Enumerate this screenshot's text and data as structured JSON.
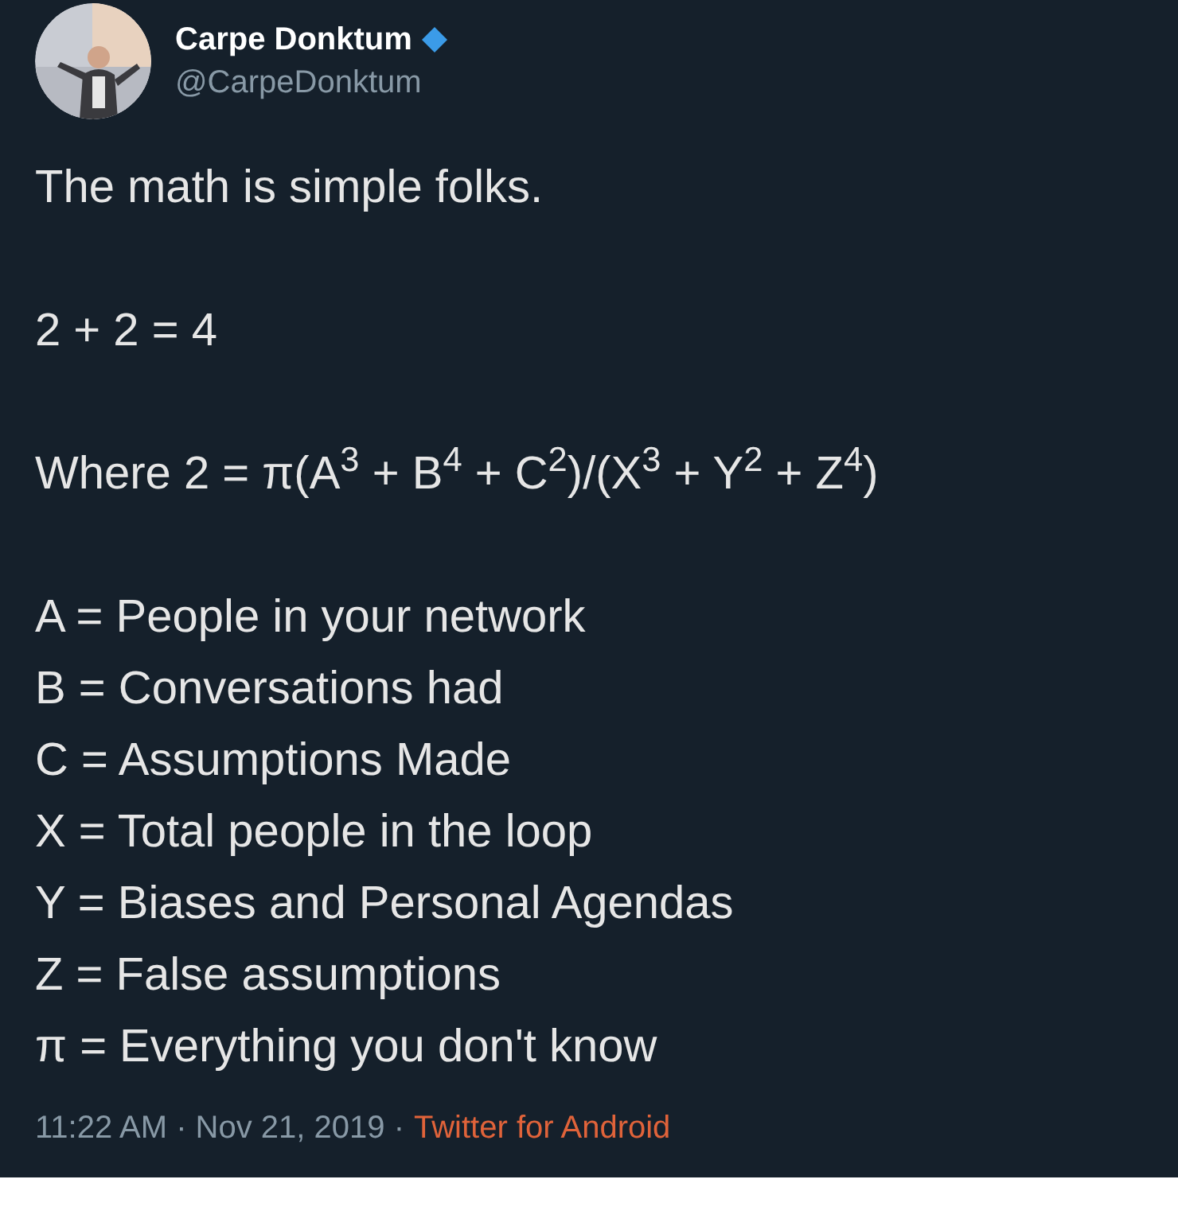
{
  "author": {
    "name": "Carpe Donktum",
    "handle": "@CarpeDonktum",
    "verified": true
  },
  "paragraphs": [
    {
      "lines": [
        "The math is simple folks."
      ]
    },
    {
      "lines": [
        "2 + 2 = 4"
      ]
    },
    {
      "lines": [
        "Where 2 = π(A$^{3}$ + B$^{4}$ + C$^{2}$)/(X$^{3}$ + Y$^{2}$ + Z$^{4}$)"
      ]
    },
    {
      "lines": [
        "A = People in your network",
        "B = Conversations had",
        "C = Assumptions Made",
        "X = Total people in the loop",
        "Y = Biases and Personal Agendas",
        "Z = False assumptions",
        "π = Everything you don't know"
      ]
    }
  ],
  "footer": {
    "timestamp": "11:22 AM · Nov 21, 2019 ·",
    "source": "Twitter for Android"
  }
}
